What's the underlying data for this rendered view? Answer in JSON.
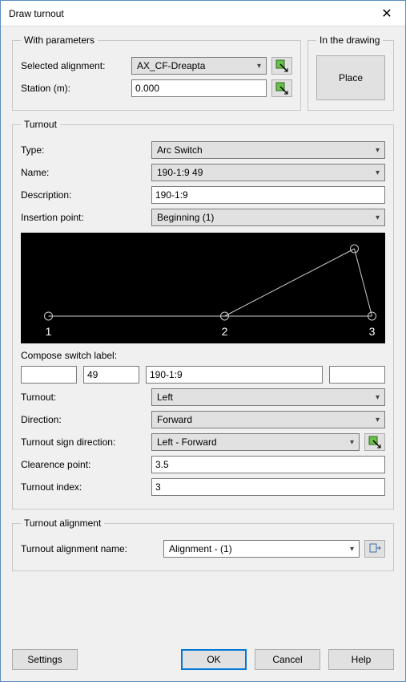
{
  "window": {
    "title": "Draw turnout"
  },
  "with_params": {
    "legend": "With parameters",
    "selected_alignment_label": "Selected alignment:",
    "selected_alignment_value": "AX_CF-Dreapta",
    "station_label": "Station (m):",
    "station_value": "0.000"
  },
  "in_drawing": {
    "legend": "In the drawing",
    "place_label": "Place"
  },
  "turnout": {
    "legend": "Turnout",
    "type_label": "Type:",
    "type_value": "Arc Switch",
    "name_label": "Name:",
    "name_value": "190-1:9 49",
    "description_label": "Description:",
    "description_value": "190-1:9",
    "insertion_point_label": "Insertion point:",
    "insertion_point_value": "Beginning (1)",
    "diagram_points": {
      "p1": "1",
      "p2": "2",
      "p3": "3"
    },
    "compose_label": "Compose switch label:",
    "compose": {
      "c1": "",
      "c2": "49",
      "c3": "190-1:9",
      "c4": ""
    },
    "turnout_label": "Turnout:",
    "turnout_value": "Left",
    "direction_label": "Direction:",
    "direction_value": "Forward",
    "sign_dir_label": "Turnout sign direction:",
    "sign_dir_value": "Left - Forward",
    "clearance_label": "Clearence point:",
    "clearance_value": "3.5",
    "index_label": "Turnout index:",
    "index_value": "3"
  },
  "turnout_alignment": {
    "legend": "Turnout alignment",
    "name_label": "Turnout alignment name:",
    "name_value": "Alignment - (1)"
  },
  "buttons": {
    "settings": "Settings",
    "ok": "OK",
    "cancel": "Cancel",
    "help": "Help"
  }
}
